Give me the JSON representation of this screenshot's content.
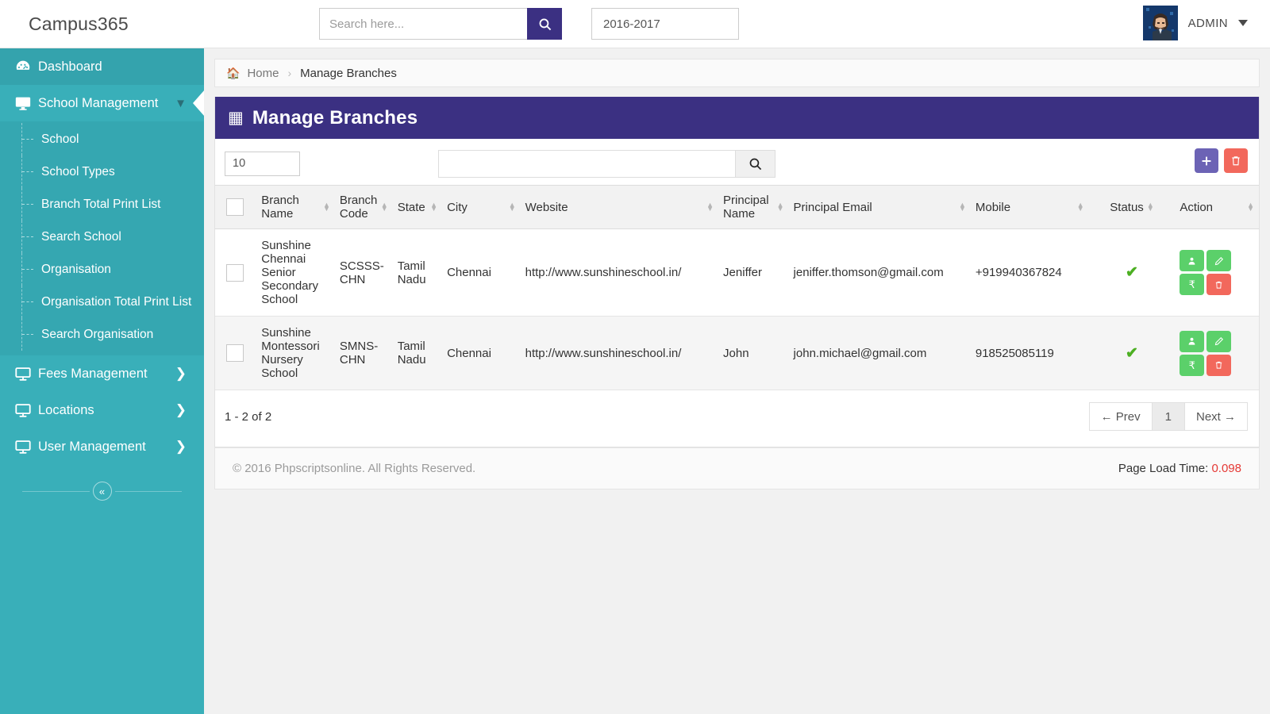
{
  "app": {
    "brand": "Campus365"
  },
  "topbar": {
    "search": {
      "placeholder": "Search here...",
      "value": "",
      "icon": "search-icon"
    },
    "academic_year": "2016-2017",
    "user": {
      "name": "ADMIN",
      "avatar_icon": "user-avatar",
      "caret_icon": "chevron-down-icon"
    }
  },
  "sidebar": {
    "items": [
      {
        "label": "Dashboard",
        "icon": "dashboard-gauge-icon",
        "state": "active",
        "expandable": false
      },
      {
        "label": "School Management",
        "icon": "monitor-icon",
        "state": "open",
        "expandable": true,
        "chevron": "chevron-down-icon"
      },
      {
        "label": "Fees Management",
        "icon": "monitor-icon",
        "state": "normal",
        "expandable": true,
        "chevron": "chevron-right-icon"
      },
      {
        "label": "Locations",
        "icon": "monitor-icon",
        "state": "normal",
        "expandable": true,
        "chevron": "chevron-right-icon"
      },
      {
        "label": "User Management",
        "icon": "monitor-icon",
        "state": "normal",
        "expandable": true,
        "chevron": "chevron-right-icon"
      }
    ],
    "submenu": [
      {
        "label": "School"
      },
      {
        "label": "School Types"
      },
      {
        "label": "Branch Total Print List"
      },
      {
        "label": "Search School"
      },
      {
        "label": "Organisation"
      },
      {
        "label": "Organisation Total Print List"
      },
      {
        "label": "Search Organisation"
      }
    ],
    "collapse": {
      "icon": "collapse-double-left-icon",
      "glyph": "«"
    }
  },
  "breadcrumb": {
    "home_icon": "home-icon",
    "home": "Home",
    "separator": "›",
    "current": "Manage Branches"
  },
  "panel": {
    "icon": "table-grid-icon",
    "title": "Manage Branches"
  },
  "toolbar": {
    "page_length": "10",
    "search": {
      "value": "",
      "placeholder": ""
    },
    "search_icon": "search-icon",
    "add_label": "+",
    "add_icon": "plus-icon",
    "delete_icon": "trash-icon"
  },
  "table": {
    "select_all_icon": "checkbox-unchecked",
    "columns": [
      {
        "label": "Branch Name",
        "sortable": true
      },
      {
        "label": "Branch Code",
        "sortable": true
      },
      {
        "label": "State",
        "sortable": true
      },
      {
        "label": "City",
        "sortable": true
      },
      {
        "label": "Website",
        "sortable": true
      },
      {
        "label": "Principal Name",
        "sortable": true
      },
      {
        "label": "Principal Email",
        "sortable": true
      },
      {
        "label": "Mobile",
        "sortable": true
      },
      {
        "label": "Status",
        "sortable": true
      },
      {
        "label": "Action",
        "sortable": false
      }
    ],
    "rows": [
      {
        "branch_name": "Sunshine Chennai Senior Secondary School",
        "branch_code": "SCSSS-CHN",
        "state": "Tamil Nadu",
        "city": "Chennai",
        "website": "http://www.sunshineschool.in/",
        "principal_name": "Jeniffer",
        "principal_email": "jeniffer.thomson@gmail.com",
        "mobile": "+919940367824",
        "status": "active",
        "status_icon": "check-icon"
      },
      {
        "branch_name": "Sunshine Montessori Nursery School",
        "branch_code": "SMNS-CHN",
        "state": "Tamil Nadu",
        "city": "Chennai",
        "website": "http://www.sunshineschool.in/",
        "principal_name": "John",
        "principal_email": "john.michael@gmail.com",
        "mobile": "918525085119",
        "status": "active",
        "status_icon": "check-icon"
      }
    ],
    "row_actions": [
      {
        "icon": "user-icon",
        "glyph": "👤",
        "color": "#5bd06a"
      },
      {
        "icon": "edit-pencil-icon",
        "glyph": "✎",
        "color": "#5bd06a"
      },
      {
        "icon": "rupee-fees-icon",
        "glyph": "₹",
        "color": "#5bd06a"
      },
      {
        "icon": "trash-icon",
        "glyph": "🗑",
        "color": "#f2685c"
      }
    ]
  },
  "pagination": {
    "info": "1 - 2 of 2",
    "prev": "← Prev",
    "current_page": "1",
    "next": "Next →"
  },
  "footer": {
    "copyright": "© 2016 Phpscriptsonline. All Rights Reserved.",
    "load_time_label": "Page Load Time:",
    "load_time_value": "0.098"
  },
  "colors": {
    "sidebar": "#39afb9",
    "sidebar_submenu": "#35a7b1",
    "panel_header": "#3b3082",
    "accent_purple": "#6c63b5",
    "danger_red": "#f2685c",
    "success_green": "#5bd06a",
    "status_check": "#4caf22",
    "load_time": "#e53935"
  }
}
